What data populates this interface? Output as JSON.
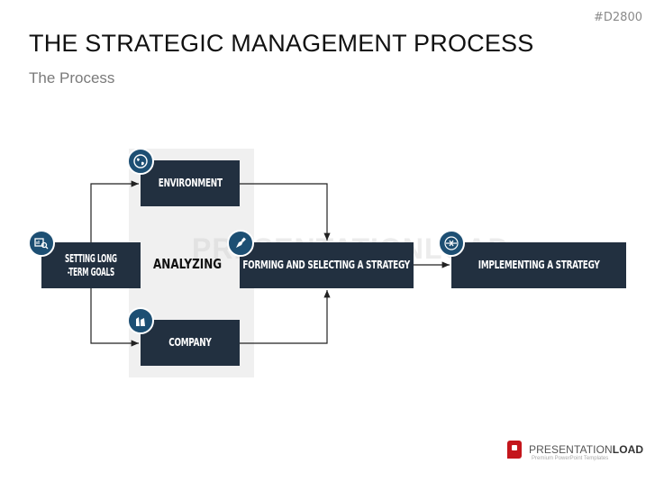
{
  "slide": {
    "code": "#D2800",
    "title": "THE STRATEGIC MANAGEMENT PROCESS",
    "subtitle": "The Process"
  },
  "diagram": {
    "group_label": "ANALYZING",
    "nodes": [
      {
        "id": "goals",
        "label_line1": "SETTING LONG",
        "label_line2": "-TERM GOALS",
        "icon": "analytics-search-icon"
      },
      {
        "id": "environment",
        "label": "ENVIRONMENT",
        "icon": "globe-icon"
      },
      {
        "id": "company",
        "label": "COMPANY",
        "icon": "factory-icon"
      },
      {
        "id": "forming",
        "label": "FORMING AND SELECTING A STRATEGY",
        "icon": "pen-nib-icon"
      },
      {
        "id": "implementing",
        "label": "IMPLEMENTING A STRATEGY",
        "icon": "arrows-converge-icon"
      }
    ],
    "edges": [
      {
        "from": "goals",
        "to": "environment"
      },
      {
        "from": "goals",
        "to": "company"
      },
      {
        "from": "environment",
        "to": "forming"
      },
      {
        "from": "company",
        "to": "forming"
      },
      {
        "from": "forming",
        "to": "implementing"
      }
    ],
    "colors": {
      "box": "#223040",
      "icon": "#1d4f73",
      "panel": "#f0f0f0"
    }
  },
  "watermark": "PRESENTATIONLOAD",
  "logo": {
    "brand_light": "PRESENTATION",
    "brand_bold": "LOAD",
    "tagline": "Premium PowerPoint Templates",
    "color": "#c4161c"
  }
}
